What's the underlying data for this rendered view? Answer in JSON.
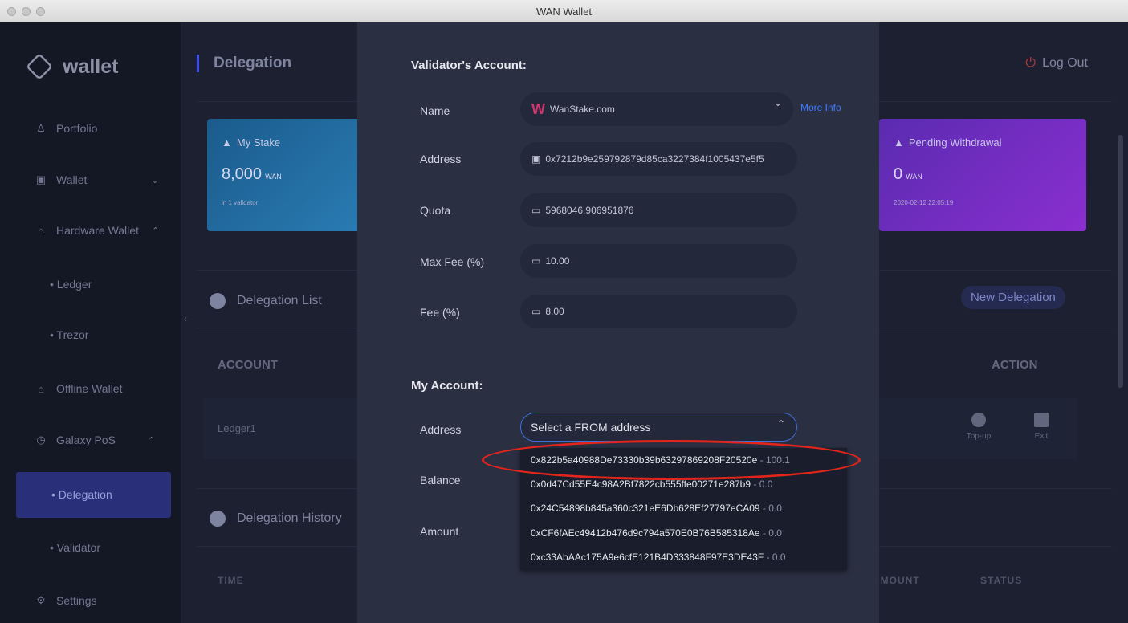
{
  "window": {
    "title": "WAN Wallet"
  },
  "sidebar": {
    "logo_text": "wallet",
    "items": [
      {
        "label": "Portfolio",
        "icon": "user-icon"
      },
      {
        "label": "Wallet",
        "icon": "wallet-icon",
        "chevron": "⌄"
      },
      {
        "label": "Hardware Wallet",
        "icon": "hardware-icon",
        "chevron": "⌃"
      },
      {
        "label": "Offline Wallet",
        "icon": "bank-icon"
      },
      {
        "label": "Galaxy PoS",
        "icon": "clock-icon",
        "chevron": "⌃"
      },
      {
        "label": "Settings",
        "icon": "gear-icon"
      }
    ],
    "sub_items": {
      "ledger": "• Ledger",
      "trezor": "• Trezor",
      "delegation": "• Delegation",
      "validator": "• Validator"
    }
  },
  "header": {
    "title": "Delegation",
    "logout_label": "Log Out"
  },
  "cards": {
    "my_stake": {
      "title": "My Stake",
      "value": "8,000",
      "unit": "WAN",
      "sub": "in 1 validator"
    },
    "pending": {
      "title": "Pending Withdrawal",
      "value": "0",
      "unit": "WAN",
      "sub": "2020-02-12 22:05:19"
    }
  },
  "delegation_list": {
    "title": "Delegation List",
    "new_button": "New Delegation",
    "headers": {
      "account": "ACCOUNT",
      "action": "ACTION"
    },
    "row": {
      "account": "Ledger1",
      "topup": "Top-up",
      "exit": "Exit"
    }
  },
  "delegation_history": {
    "title": "Delegation History",
    "headers": [
      "TIME",
      "AMOUNT",
      "STATUS"
    ]
  },
  "modal": {
    "validator_heading": "Validator's Account:",
    "labels": {
      "name": "Name",
      "address": "Address",
      "quota": "Quota",
      "max_fee": "Max Fee (%)",
      "fee": "Fee (%)",
      "my_address": "Address",
      "balance": "Balance",
      "amount": "Amount"
    },
    "validator": {
      "name": "WanStake.com",
      "more_info": "More Info",
      "address": "0x7212b9e259792879d85ca3227384f1005437e5f5",
      "quota": "5968046.906951876",
      "max_fee": "10.00",
      "fee": "8.00"
    },
    "my_account_heading": "My Account:",
    "from_placeholder": "Select a FROM address",
    "addresses": [
      {
        "addr": "0x822b5a40988De73330b39b63297869208F20520e",
        "bal": " - 100.1"
      },
      {
        "addr": "0x0d47Cd55E4c98A2Bf7822cb555ffe00271e287b9",
        "bal": " - 0.0"
      },
      {
        "addr": "0x24C54898b845a360c321eE6Db628Ef27797eCA09",
        "bal": " - 0.0"
      },
      {
        "addr": "0xCF6fAEc49412b476d9c794a570E0B76B585318Ae",
        "bal": " - 0.0"
      },
      {
        "addr": "0xc33AbAAc175A9e6cfE121B4D333848F97E3DE43F",
        "bal": " - 0.0"
      }
    ]
  },
  "colors": {
    "highlight_ring": "#e1251b",
    "accent": "#3f7cff",
    "active_nav": "#2a2f7a"
  }
}
